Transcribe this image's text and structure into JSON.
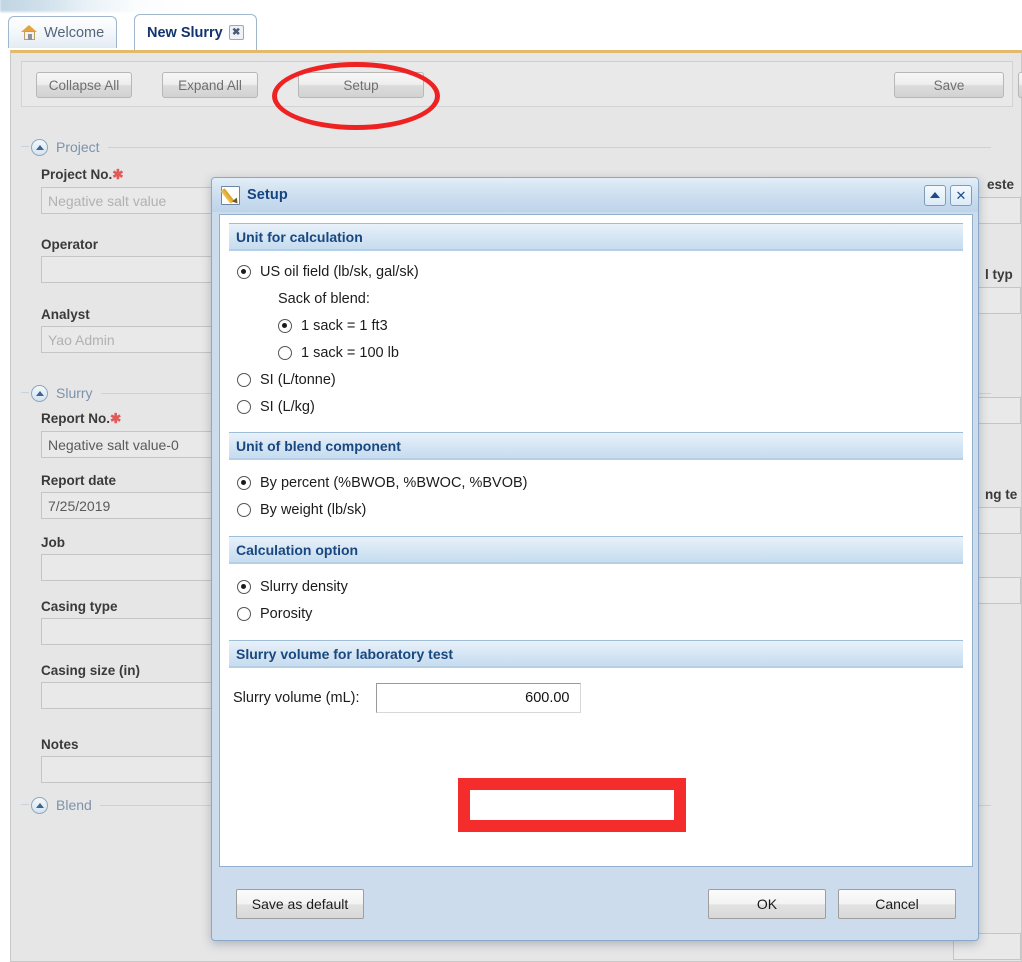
{
  "window": {
    "watermark": ""
  },
  "tabs": [
    {
      "label": "Welcome",
      "icon": "home-icon",
      "active": false,
      "closable": false
    },
    {
      "label": "New Slurry",
      "icon": "none",
      "active": true,
      "closable": true,
      "close_glyph": "✖"
    }
  ],
  "toolbar": {
    "collapse_all_label": "Collapse All",
    "expand_all_label": "Expand All",
    "setup_label": "Setup",
    "save_label": "Save",
    "extra_label": ""
  },
  "form": {
    "groups": [
      {
        "name": "project_group",
        "label": "Project"
      },
      {
        "name": "slurry_group",
        "label": "Slurry"
      },
      {
        "name": "blend_group",
        "label": "Blend"
      }
    ],
    "fields": [
      {
        "name": "project-no",
        "label": "Project No.",
        "required": true,
        "value": "Negative salt value",
        "is_placeholder": true
      },
      {
        "name": "operator",
        "label": "Operator",
        "required": false,
        "value": "",
        "is_placeholder": false
      },
      {
        "name": "analyst",
        "label": "Analyst",
        "required": false,
        "value": "Yao Admin",
        "is_placeholder": true
      },
      {
        "name": "report-no",
        "label": "Report No.",
        "required": true,
        "value": "Negative salt value-0",
        "is_placeholder": false
      },
      {
        "name": "report-date",
        "label": "Report date",
        "required": false,
        "value": "7/25/2019",
        "is_placeholder": false
      },
      {
        "name": "job",
        "label": "Job",
        "required": false,
        "value": "",
        "is_placeholder": false
      },
      {
        "name": "casing-type",
        "label": "Casing type",
        "required": false,
        "value": "",
        "is_placeholder": false
      },
      {
        "name": "casing-size",
        "label": "Casing size (in)",
        "required": false,
        "value": "",
        "is_placeholder": false
      },
      {
        "name": "notes",
        "label": "Notes",
        "required": false,
        "value": "",
        "is_placeholder": false
      }
    ],
    "clipped_right_labels": [
      {
        "name": "requested-by-label",
        "text": "este"
      },
      {
        "name": "well-type-label",
        "text": "l typ"
      },
      {
        "name": "testing-temp-label",
        "text": "ng te"
      }
    ]
  },
  "dialog": {
    "title": "Setup",
    "title_icon": "pencil-edit-icon",
    "controls": {
      "collapse": "collapse-icon",
      "close": "✕"
    },
    "sections": [
      {
        "name": "unit-for-calculation",
        "header": "Unit for calculation",
        "options": [
          {
            "name": "us-oil-field",
            "label": "US oil field (lb/sk, gal/sk)",
            "selected": true,
            "indent": 0
          },
          {
            "name": "sack-of-blend",
            "label": "Sack of blend:",
            "selected": null,
            "indent": 1
          },
          {
            "name": "sack-1-ft3",
            "label": "1 sack = 1 ft3",
            "selected": true,
            "indent": 2
          },
          {
            "name": "sack-100-lb",
            "label": "1 sack = 100 lb",
            "selected": false,
            "indent": 2
          },
          {
            "name": "si-l-tonne",
            "label": "SI (L/tonne)",
            "selected": false,
            "indent": 0
          },
          {
            "name": "si-l-kg",
            "label": "SI (L/kg)",
            "selected": false,
            "indent": 0
          }
        ]
      },
      {
        "name": "unit-of-blend-component",
        "header": "Unit of blend component",
        "options": [
          {
            "name": "by-percent",
            "label": "By percent (%BWOB, %BWOC, %BVOB)",
            "selected": true,
            "indent": 0
          },
          {
            "name": "by-weight",
            "label": "By weight (lb/sk)",
            "selected": false,
            "indent": 0
          }
        ]
      },
      {
        "name": "calculation-option",
        "header": "Calculation option",
        "options": [
          {
            "name": "slurry-density",
            "label": "Slurry density",
            "selected": true,
            "indent": 0
          },
          {
            "name": "porosity",
            "label": "Porosity",
            "selected": false,
            "indent": 0
          }
        ]
      },
      {
        "name": "slurry-volume-for-lab-test",
        "header": "Slurry volume for laboratory test",
        "field": {
          "name": "slurry-volume",
          "label": "Slurry volume (mL):",
          "value": "600.00"
        }
      }
    ],
    "buttons": {
      "save_as_default": "Save as default",
      "ok": "OK",
      "cancel": "Cancel"
    }
  },
  "annotations": {
    "ellipse_target": "setup-button",
    "rect_target": "slurry-volume-input",
    "color": "#ee2222"
  }
}
